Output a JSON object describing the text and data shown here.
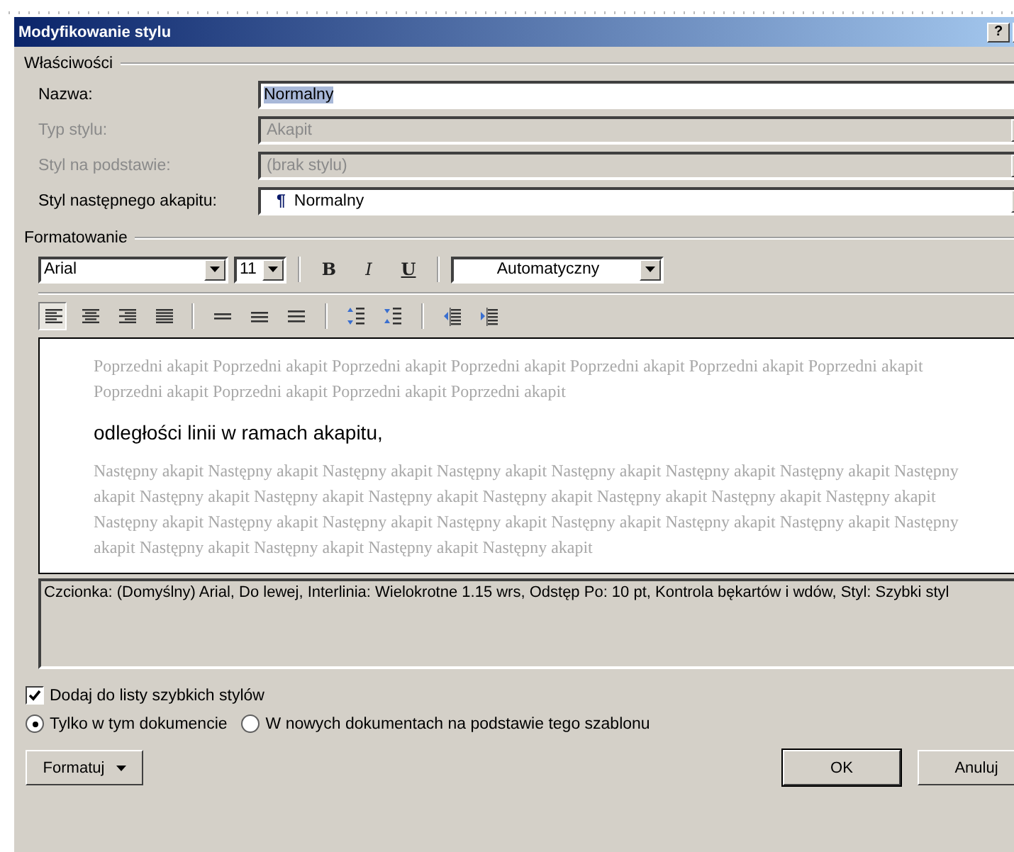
{
  "window": {
    "title": "Modyfikowanie stylu",
    "help_label": "?"
  },
  "properties": {
    "heading": "Właściwości",
    "fields": [
      {
        "kind": "text",
        "label": "Nazwa:",
        "disabled": false,
        "value": "Normalny",
        "value_selected": true
      },
      {
        "kind": "select",
        "label": "Typ stylu:",
        "disabled": true,
        "value": "Akapit"
      },
      {
        "kind": "select",
        "label": "Styl na podstawie:",
        "disabled": true,
        "value": "(brak stylu)"
      },
      {
        "kind": "select",
        "label": "Styl następnego akapitu:",
        "disabled": false,
        "prefix": "¶",
        "value": "Normalny"
      }
    ]
  },
  "formatting": {
    "heading": "Formatowanie",
    "font": "Arial",
    "size": "11",
    "style_buttons": [
      {
        "kind": "bold",
        "label": "B"
      },
      {
        "kind": "italic",
        "label": "I"
      },
      {
        "kind": "underline",
        "label": "U"
      }
    ],
    "font_color_label": "Automatyczny",
    "tools": [
      {
        "kind": "align-left",
        "selected": true
      },
      {
        "kind": "align-center",
        "selected": false
      },
      {
        "kind": "align-right",
        "selected": false
      },
      {
        "kind": "justify",
        "selected": false
      },
      {
        "kind": "sep"
      },
      {
        "kind": "single",
        "selected": false
      },
      {
        "kind": "onehalf",
        "selected": false
      },
      {
        "kind": "double",
        "selected": false
      },
      {
        "kind": "sep"
      },
      {
        "kind": "space-more",
        "selected": false
      },
      {
        "kind": "space-less",
        "selected": false
      },
      {
        "kind": "sep"
      },
      {
        "kind": "indent-less",
        "selected": false
      },
      {
        "kind": "indent-more",
        "selected": false
      }
    ]
  },
  "preview": {
    "previous": "Poprzedni akapit Poprzedni akapit Poprzedni akapit Poprzedni akapit Poprzedni akapit Poprzedni akapit Poprzedni akapit Poprzedni akapit Poprzedni akapit Poprzedni akapit Poprzedni akapit",
    "sample": "odległości linii w ramach akapitu,",
    "next": "Następny akapit Następny akapit Następny akapit Następny akapit Następny akapit Następny akapit Następny akapit Następny akapit Następny akapit Następny akapit Następny akapit Następny akapit Następny akapit Następny akapit Następny akapit Następny akapit Następny akapit Następny akapit Następny akapit Następny akapit Następny akapit Następny akapit Następny akapit Następny akapit Następny akapit Następny akapit Następny akapit"
  },
  "description": "Czcionka: (Domyślny) Arial, Do lewej, Interlinia:  Wielokrotne 1.15 wrs, Odstęp Po:  10 pt, Kontrola bękartów i wdów, Styl: Szybki styl",
  "quick_style": {
    "label": "Dodaj do listy szybkich stylów",
    "checked": true
  },
  "scope": [
    {
      "label": "Tylko w tym dokumencie",
      "selected": true
    },
    {
      "label": "W nowych dokumentach na podstawie tego szablonu",
      "selected": false
    }
  ],
  "buttons": [
    {
      "kind": "menu",
      "label": "Formatuj",
      "default": false
    },
    {
      "kind": "plain",
      "label": "OK",
      "default": true
    },
    {
      "kind": "plain",
      "label": "Anuluj",
      "default": false
    }
  ]
}
